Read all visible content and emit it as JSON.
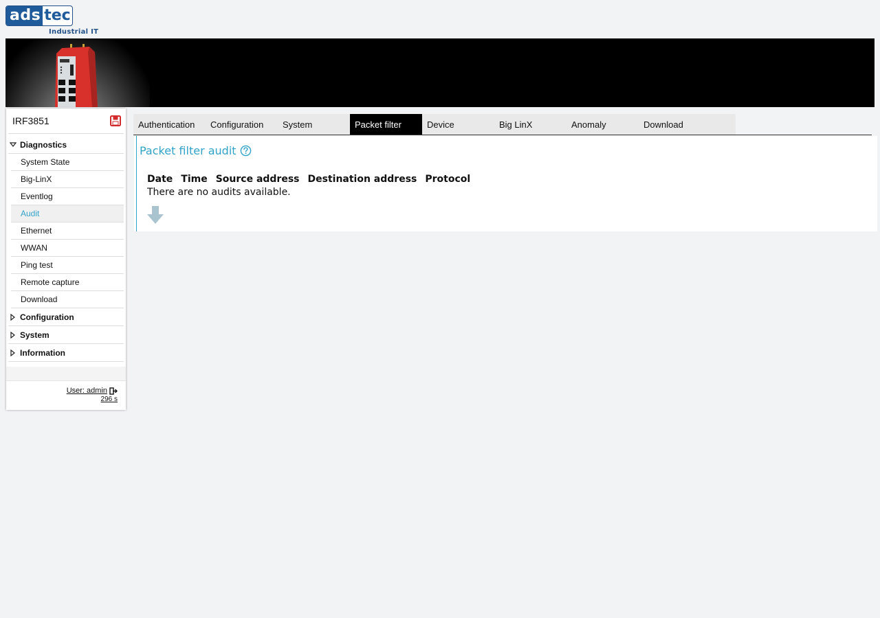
{
  "brand": {
    "logo_left": "ads",
    "logo_right": "tec",
    "tagline": "Industrial IT"
  },
  "device": {
    "name": "IRF3851"
  },
  "sidebar": {
    "groups": [
      {
        "label": "Diagnostics",
        "expanded": true,
        "items": [
          "System State",
          "Big-LinX",
          "Eventlog",
          "Audit",
          "Ethernet",
          "WWAN",
          "Ping test",
          "Remote capture",
          "Download"
        ],
        "active": "Audit"
      },
      {
        "label": "Configuration",
        "expanded": false
      },
      {
        "label": "System",
        "expanded": false
      },
      {
        "label": "Information",
        "expanded": false
      }
    ],
    "user_label": "User: admin",
    "session_timer": "296 s"
  },
  "tabs": {
    "items": [
      "Authentication",
      "Configuration",
      "System",
      "Packet filter",
      "Device",
      "Big LinX",
      "Anomaly",
      "Download"
    ],
    "active": "Packet filter"
  },
  "main": {
    "title": "Packet filter audit",
    "columns": [
      "Date",
      "Time",
      "Source address",
      "Destination address",
      "Protocol"
    ],
    "empty_message": "There are no audits available."
  },
  "colors": {
    "accent": "#31a3c9",
    "brand_blue": "#1f5b9a",
    "device_red": "#d8302a",
    "active_tab_bg": "#000000"
  },
  "icons": {
    "save": "save-disk-icon",
    "help": "question-circle-icon",
    "logout": "logout-icon",
    "download": "arrow-down-icon",
    "expanded": "triangle-down-icon",
    "collapsed": "triangle-right-icon"
  }
}
